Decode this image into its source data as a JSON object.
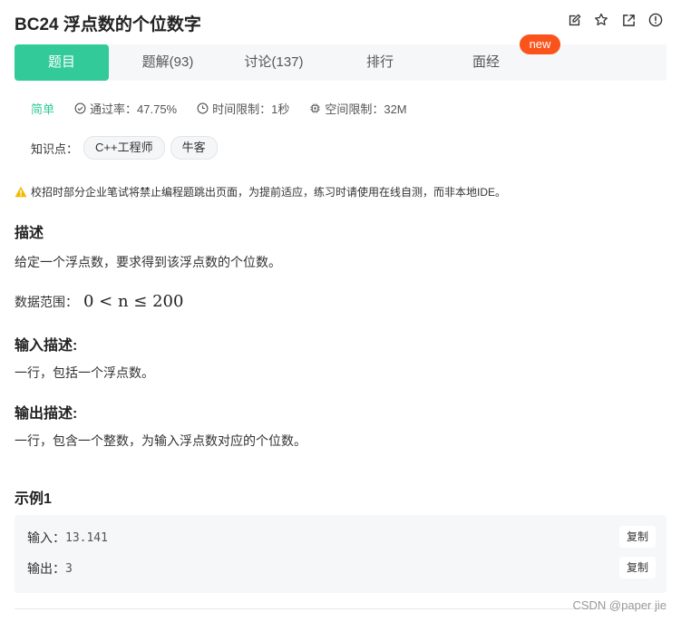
{
  "title": "BC24  浮点数的个位数字",
  "tabs": [
    {
      "label": "题目"
    },
    {
      "label": "题解(93)"
    },
    {
      "label": "讨论(137)"
    },
    {
      "label": "排行"
    },
    {
      "label": "面经"
    }
  ],
  "new_badge": "new",
  "meta": {
    "difficulty": "简单",
    "pass_rate": "通过率：47.75%",
    "time_limit": "时间限制：1秒",
    "space_limit": "空间限制：32M"
  },
  "knowledge": {
    "label": "知识点：",
    "tags": [
      "C++工程师",
      "牛客"
    ]
  },
  "notice": "校招时部分企业笔试将禁止编程题跳出页面，为提前适应，练习时请使用在线自测，而非本地IDE。",
  "description": {
    "heading": "描述",
    "text": "给定一个浮点数，要求得到该浮点数的个位数。",
    "range_label": "数据范围：",
    "range_math": "0 < n ≤ 200"
  },
  "input_desc": {
    "heading": "输入描述:",
    "text": "一行，包括一个浮点数。"
  },
  "output_desc": {
    "heading": "输出描述:",
    "text": "一行，包含一个整数，为输入浮点数对应的个位数。"
  },
  "example": {
    "heading": "示例1",
    "input_label": "输入：",
    "input_value": "13.141",
    "output_label": "输出：",
    "output_value": "3",
    "copy_label": "复制"
  },
  "watermark": "CSDN @paper jie",
  "colors": {
    "accent": "#32ca99",
    "badge": "#fa541c",
    "warning": "#f5b800"
  }
}
